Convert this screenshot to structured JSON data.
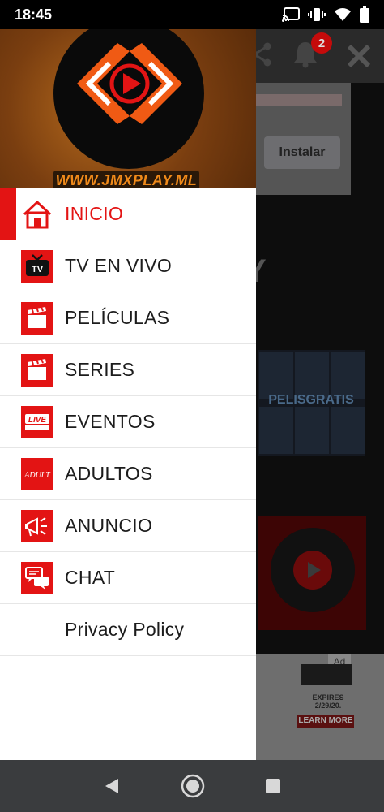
{
  "status_bar": {
    "time": "18:45"
  },
  "background": {
    "notification_count": "2",
    "install_label": "Instalar",
    "partial_heading": "Y",
    "promo_brand": "PELISGRATIS",
    "ad_label": "Ad",
    "ad_expires": "EXPIRES 2/29/20.",
    "ad_button": "LEARN MORE"
  },
  "drawer": {
    "header_url": "WWW.JMXPLAY.ML",
    "items": [
      {
        "label": "INICIO",
        "icon": "home-icon",
        "active": true
      },
      {
        "label": "TV EN VIVO",
        "icon": "tv-icon",
        "active": false
      },
      {
        "label": "PELÍCULAS",
        "icon": "clapperboard-icon",
        "active": false
      },
      {
        "label": "SERIES",
        "icon": "clapperboard-icon",
        "active": false
      },
      {
        "label": "EVENTOS",
        "icon": "live-streaming-icon",
        "active": false
      },
      {
        "label": "ADULTOS",
        "icon": "adult-icon",
        "active": false
      },
      {
        "label": "ANUNCIO",
        "icon": "megaphone-icon",
        "active": false
      },
      {
        "label": "CHAT",
        "icon": "chat-icon",
        "active": false
      },
      {
        "label": "Privacy Policy",
        "icon": "",
        "active": false
      }
    ]
  },
  "colors": {
    "accent": "#e31414",
    "header_orange": "#f08a1a"
  }
}
